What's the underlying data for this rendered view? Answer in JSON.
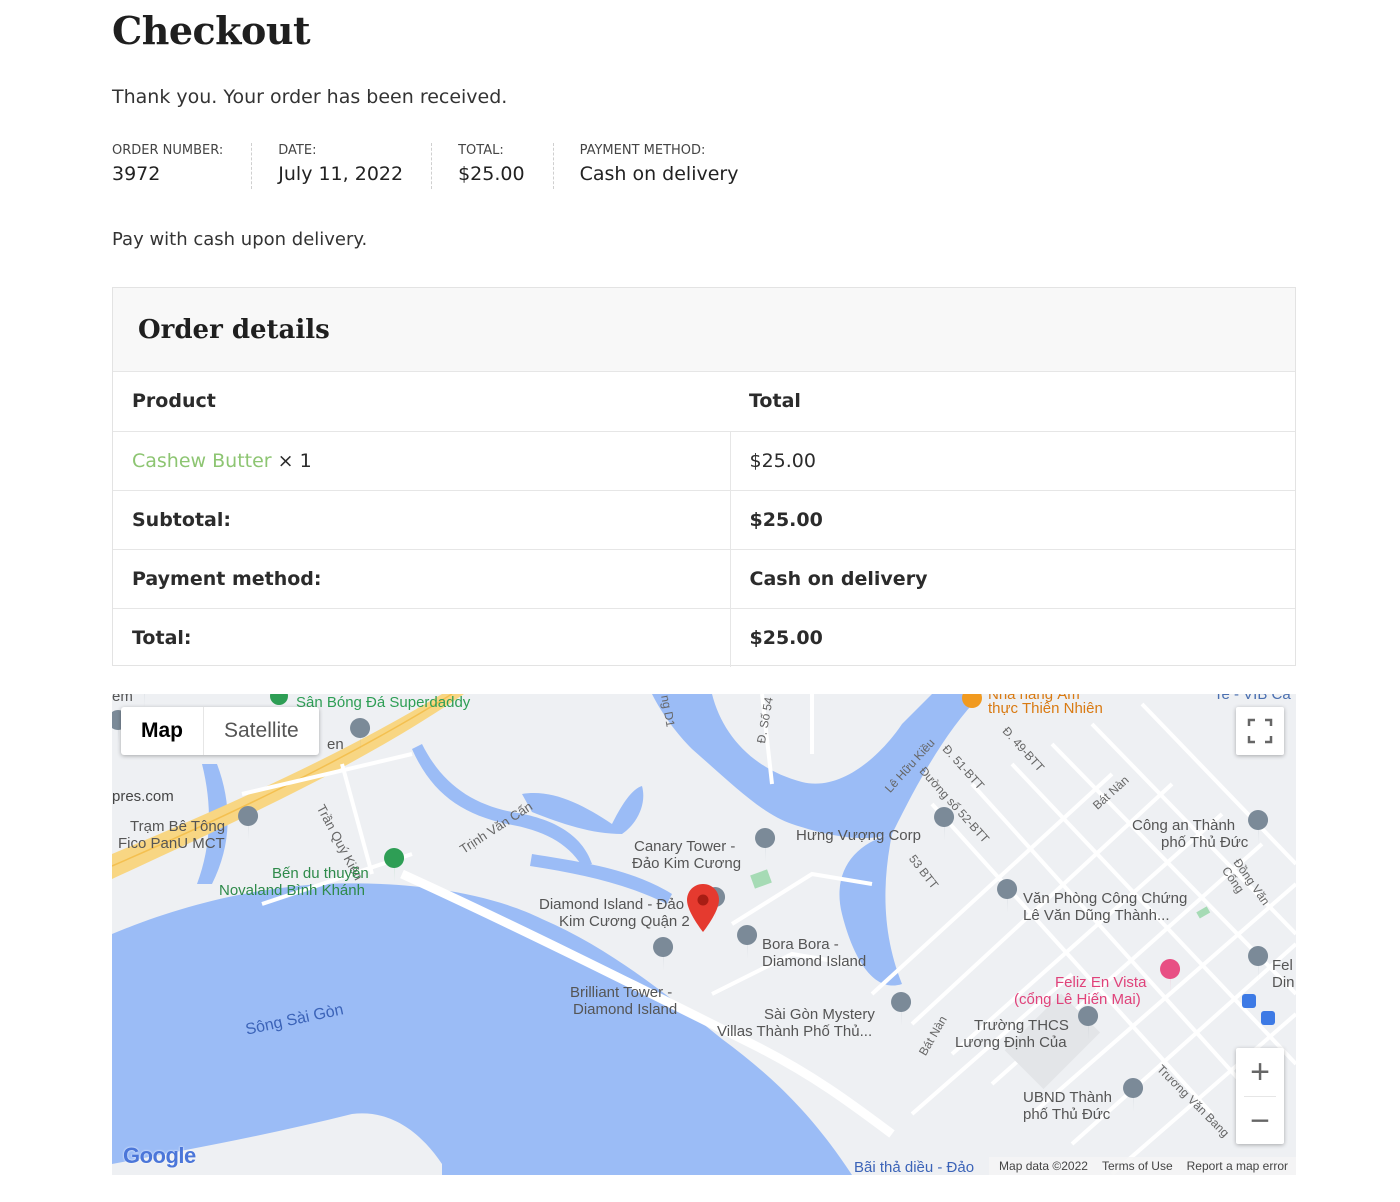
{
  "page": {
    "title": "Checkout",
    "thank_you": "Thank you. Your order has been received.",
    "payment_note": "Pay with cash upon delivery."
  },
  "overview": {
    "order_number_label": "ORDER NUMBER:",
    "order_number": "3972",
    "date_label": "DATE:",
    "date": "July 11, 2022",
    "total_label": "TOTAL:",
    "total": "$25.00",
    "payment_label": "PAYMENT METHOD:",
    "payment": "Cash on delivery"
  },
  "order_details": {
    "heading": "Order details",
    "col_product": "Product",
    "col_total": "Total",
    "item_name": "Cashew Butter",
    "item_qty": "× 1",
    "item_total": "$25.00",
    "subtotal_label": "Subtotal:",
    "subtotal": "$25.00",
    "payment_label": "Payment method:",
    "payment": "Cash on delivery",
    "total_label": "Total:",
    "total": "$25.00",
    "link_color": "#8dc572"
  },
  "map": {
    "type_map": "Map",
    "type_satellite": "Satellite",
    "zoom_in": "+",
    "zoom_out": "−",
    "logo": "Google",
    "footer": {
      "data": "Map data ©2022",
      "terms": "Terms of Use",
      "report": "Report a map error"
    },
    "icons": {
      "fullscreen": "fullscreen-icon",
      "pin": "map-pin-icon"
    },
    "colors": {
      "water": "#9bbcf6",
      "land": "#eef0f3",
      "highway": "#f8d683",
      "pin": "#e53a2f",
      "poi_pink": "#e84f84",
      "poi_green": "#2e9e55"
    },
    "labels": {
      "sb": "Sân Bóng Đá Superdaddy",
      "nha_hang_1": "Nhà hàng Ẩm",
      "nha_hang_2": "thực Thiên Nhiên",
      "vib": "Te - VIB Ca",
      "em": "em",
      "pres": "pres.com",
      "en": "en",
      "tram1": "Trạm Bê Tông",
      "tram2": "Fico PanU MCT",
      "tran_quy_kien": "Trần Quý Kiên",
      "trinh_van_can": "Trịnh Văn Cấn",
      "ben1": "Bến du thuyền",
      "ben2": "Novaland Bình Khánh",
      "canary1": "Canary Tower -",
      "canary2": "Đảo Kim Cương",
      "hung_vuong": "Hưng Vượng Corp",
      "le_huu_kieu": "Lê Hữu Kiều",
      "d51": "Đ. 51-BTT",
      "d52": "Đường số 52-BTT",
      "d49": "Đ. 49-BTT",
      "bat_nan": "Bát Nàn",
      "bat_nan_2": "Bát Nàn",
      "cong_an1": "Công an Thành",
      "cong_an2": "phố Thủ Đức",
      "dong_van_cong": "Đồng Văn Cống",
      "b53": "53 BTT",
      "van_phong1": "Văn Phòng Công Chứng",
      "van_phong2": "Lê Văn Dũng Thành...",
      "diamond1": "Diamond Island - Đảo",
      "diamond2": "Kim Cương Quận 2",
      "bora1": "Bora Bora -",
      "bora2": "Diamond Island",
      "brilliant1": "Brilliant Tower -",
      "brilliant2": "Diamond Island",
      "song": "Sông Sài Gòn",
      "mystery1": "Sài Gòn Mystery",
      "mystery2": "Villas Thành Phố Thủ...",
      "feliz1": "Feliz En Vista",
      "feliz2": "(cổng Lê Hiến Mai)",
      "truong1": "Trường THCS",
      "truong2": "Lương Định Của",
      "ubnd1": "UBND Thành",
      "ubnd2": "phố Thủ Đức",
      "truong_van_bang": "Trương Văn Bang",
      "bai_tha": "Bãi thả diều - Đảo",
      "fel1": "Fel",
      "fel2": "Din",
      "d_so_54": "Đ. Số 54",
      "d1": "ng D1"
    }
  }
}
